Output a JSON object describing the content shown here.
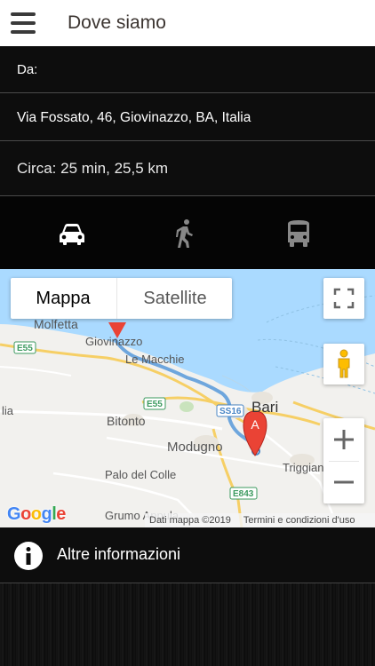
{
  "header": {
    "title": "Dove siamo",
    "menu_icon": "hamburger-menu-icon"
  },
  "route": {
    "from_label": "Da:",
    "address": "Via Fossato, 46, Giovinazzo, BA, Italia",
    "estimate": "Circa: 25 min, 25,5 km"
  },
  "travel_modes": [
    {
      "name": "car",
      "icon": "car-icon",
      "selected": true
    },
    {
      "name": "walk",
      "icon": "walking-icon",
      "selected": false
    },
    {
      "name": "transit",
      "icon": "bus-icon",
      "selected": false
    }
  ],
  "map": {
    "type_buttons": {
      "map": "Mappa",
      "satellite": "Satellite"
    },
    "zoom_in": "+",
    "zoom_out": "−",
    "marker_label": "A",
    "places": {
      "molfetta": "Molfetta",
      "giovinazzo": "Giovinazzo",
      "le_macchie": "Le Macchie",
      "bari": "Bari",
      "bitonto": "Bitonto",
      "modugno": "Modugno",
      "palo": "Palo del Colle",
      "triggiano": "Triggian",
      "grumo": "Grumo Appula",
      "lia": "lia",
      "e55a": "E55",
      "e55b": "E55",
      "ss16": "SS16",
      "e843": "E843"
    },
    "logo": "Google",
    "attribution": "Dati mappa ©2019",
    "terms": "Termini e condizioni d'uso"
  },
  "more_info": {
    "label": "Altre informazioni",
    "icon": "info-icon"
  },
  "colors": {
    "header_bg": "#ffffff",
    "panel_bg": "#0d0d0d",
    "route": "#5b9bd5",
    "sea": "#aadaff",
    "marker": "#ea4335"
  }
}
